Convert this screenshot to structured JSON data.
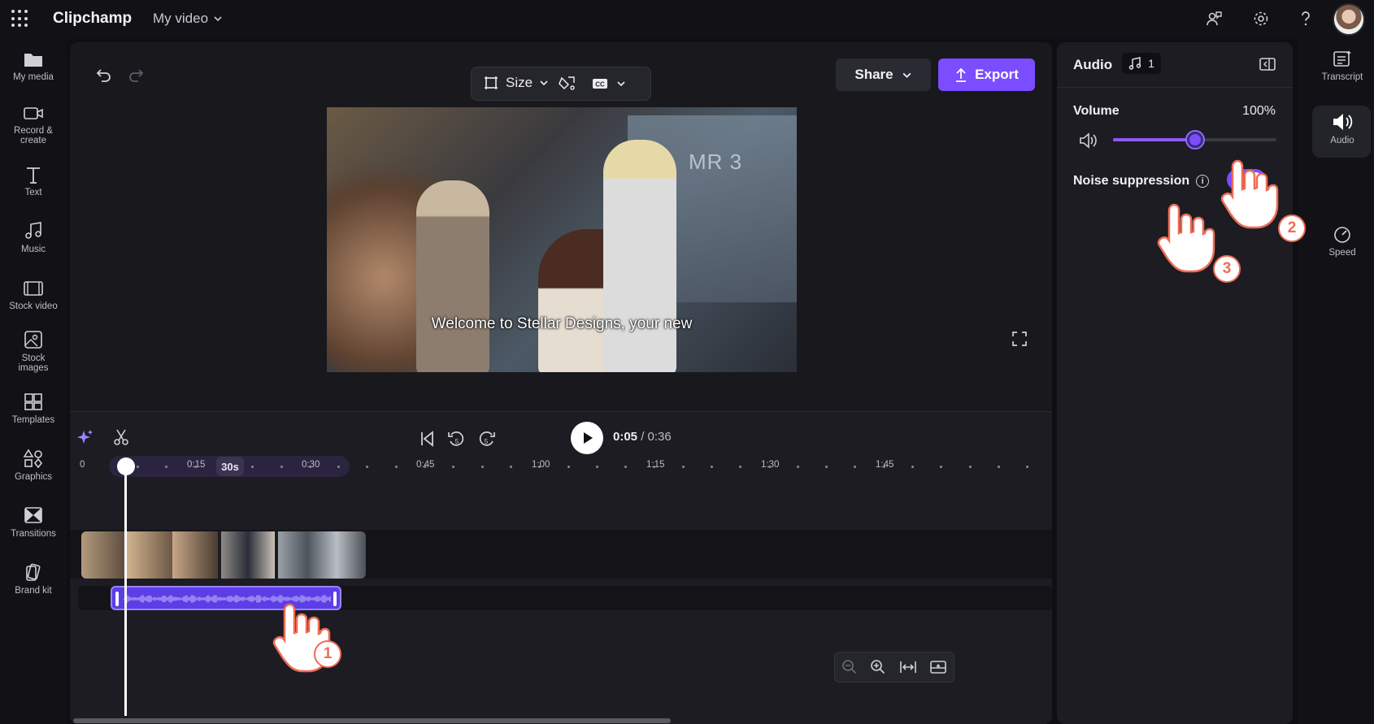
{
  "app": {
    "name": "Clipchamp",
    "project_title": "My video"
  },
  "left_nav": [
    {
      "label": "My media",
      "icon": "folder-icon"
    },
    {
      "label": "Record &\ncreate",
      "icon": "camera-icon"
    },
    {
      "label": "Text",
      "icon": "text-icon"
    },
    {
      "label": "Music",
      "icon": "music-icon"
    },
    {
      "label": "Stock video",
      "icon": "film-icon"
    },
    {
      "label": "Stock\nimages",
      "icon": "image-icon"
    },
    {
      "label": "Templates",
      "icon": "templates-icon"
    },
    {
      "label": "Graphics",
      "icon": "shapes-icon"
    },
    {
      "label": "Transitions",
      "icon": "transitions-icon"
    },
    {
      "label": "Brand kit",
      "icon": "brand-kit-icon"
    }
  ],
  "toolbar": {
    "size_label": "Size",
    "share_label": "Share",
    "export_label": "Export"
  },
  "preview": {
    "caption": "Welcome to Stellar Designs, your new",
    "sign_text": "MR 3"
  },
  "playback": {
    "current_time": "0:05",
    "total_time": "/ 0:36",
    "skip_seconds": "5"
  },
  "ruler": {
    "labels": [
      "0",
      "0:15",
      "0:30",
      "0:45",
      "1:00",
      "1:15",
      "1:30",
      "1:45"
    ],
    "zoom_badge": "30s"
  },
  "audio_panel": {
    "title": "Audio",
    "track_count": "1",
    "volume_label": "Volume",
    "volume_value": "100%",
    "volume_level": 0.5,
    "noise_label": "Noise suppression",
    "noise_on": true
  },
  "right_rail": [
    {
      "label": "Transcript",
      "icon": "transcript-icon"
    },
    {
      "label": "Audio",
      "icon": "speaker-icon",
      "active": true
    },
    {
      "label": "Speed",
      "icon": "speedometer-icon"
    }
  ],
  "steps": [
    "1",
    "2",
    "3"
  ],
  "colors": {
    "accent": "#7b4dff",
    "step_ring": "#ef6c55",
    "background": "#0f0f13"
  }
}
